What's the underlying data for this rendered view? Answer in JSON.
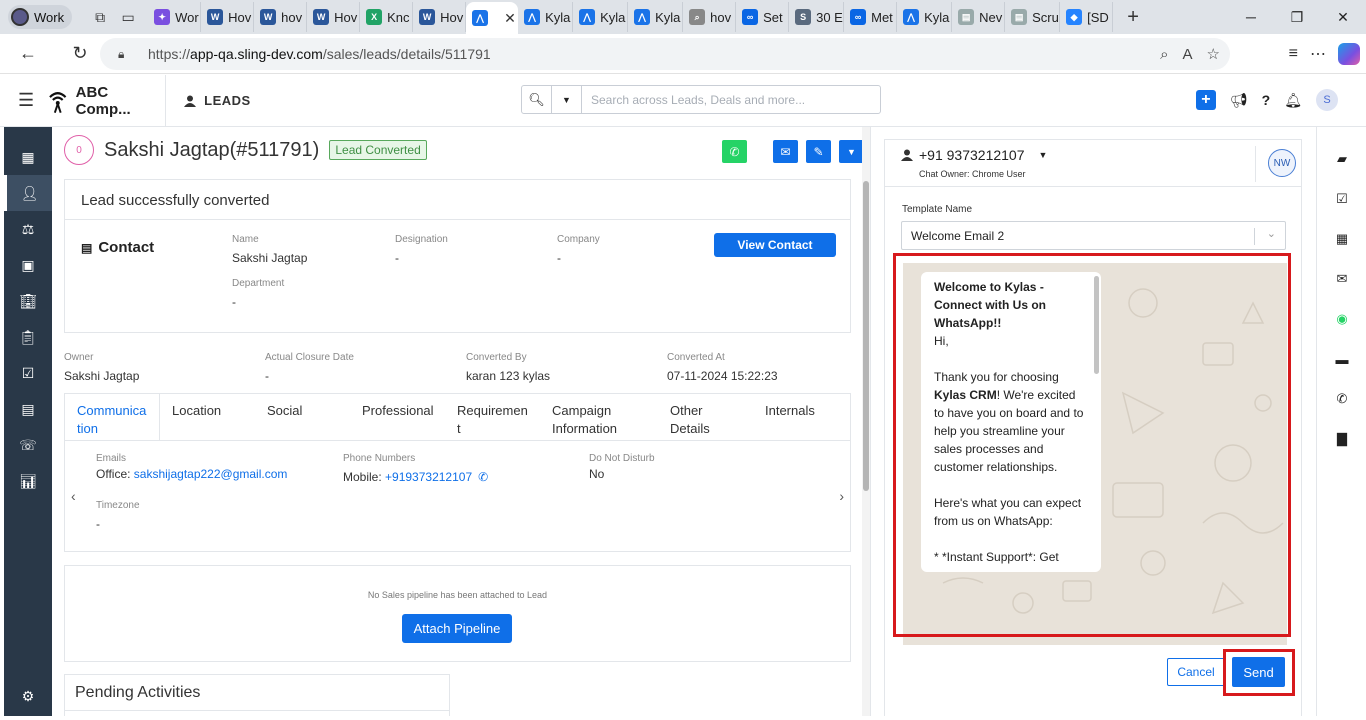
{
  "browser": {
    "profile_label": "Work",
    "tabs": [
      {
        "label": "Wor",
        "icon": "copilot-icon"
      },
      {
        "label": "Hov",
        "icon": "word-icon"
      },
      {
        "label": "hov",
        "icon": "word-icon"
      },
      {
        "label": "Hov",
        "icon": "word-icon"
      },
      {
        "label": "Knc",
        "icon": "excel-icon"
      },
      {
        "label": "Hov",
        "icon": "word-icon"
      },
      {
        "label": "",
        "icon": "kylas-icon"
      },
      {
        "label": "Kyla",
        "icon": "kylas-icon"
      },
      {
        "label": "Kyla",
        "icon": "kylas-icon"
      },
      {
        "label": "Kyla",
        "icon": "kylas-icon"
      },
      {
        "label": "hov",
        "icon": "search-icon"
      },
      {
        "label": "Set",
        "icon": "meta-icon"
      },
      {
        "label": "30 E",
        "icon": "s-icon"
      },
      {
        "label": "Met",
        "icon": "meta-icon"
      },
      {
        "label": "Kyla",
        "icon": "kylas-icon"
      },
      {
        "label": "Nev",
        "icon": "page-icon"
      },
      {
        "label": "Scru",
        "icon": "page-icon"
      },
      {
        "label": "[SD",
        "icon": "jira-icon"
      }
    ],
    "url_prefix": "https://",
    "url_host": "app-qa.sling-dev.com",
    "url_path": "/sales/leads/details/511791"
  },
  "header": {
    "company": "ABC Comp...",
    "module": "LEADS",
    "search_placeholder": "Search across Leads, Deals and more...",
    "avatar_letter": "S"
  },
  "lead": {
    "avatar_text": "0",
    "name": "Sakshi Jagtap(#511791)",
    "status_badge": "Lead Converted"
  },
  "conversion": {
    "banner": "Lead successfully converted",
    "contact_heading": "Contact",
    "name_label": "Name",
    "name_value": "Sakshi Jagtap",
    "designation_label": "Designation",
    "designation_value": "-",
    "company_label": "Company",
    "company_value": "-",
    "department_label": "Department",
    "department_value": "-",
    "view_contact": "View Contact"
  },
  "summary": {
    "owner_label": "Owner",
    "owner_value": "Sakshi Jagtap",
    "closure_label": "Actual Closure Date",
    "closure_value": "-",
    "converted_by_label": "Converted By",
    "converted_by_value": "karan 123 kylas",
    "converted_at_label": "Converted At",
    "converted_at_value": "07-11-2024 15:22:23"
  },
  "detail_tabs": [
    "Communica tion",
    "Location",
    "Social",
    "Professional",
    "Requiremen t",
    "Campaign Information",
    "Other Details",
    "Internals"
  ],
  "communication": {
    "emails_label": "Emails",
    "email_prefix": "Office: ",
    "email_value": "sakshijagtap222@gmail.com",
    "phones_label": "Phone Numbers",
    "phone_prefix": "Mobile: ",
    "phone_value": "+919373212107",
    "dnd_label": "Do Not Disturb",
    "dnd_value": "No",
    "timezone_label": "Timezone",
    "timezone_value": "-"
  },
  "pipeline": {
    "message": "No Sales pipeline has been attached to Lead",
    "button": "Attach Pipeline"
  },
  "pending": {
    "title": "Pending Activities"
  },
  "chat": {
    "phone": "+91 9373212107",
    "owner_label": "Chat Owner:",
    "owner_value": "Chrome User",
    "agent_initials": "NW",
    "template_label": "Template Name",
    "template_value": "Welcome Email 2",
    "message_title": "Welcome to Kylas - Connect with Us on WhatsApp!!",
    "message_greeting": "Hi,",
    "message_p1_a": "Thank you for choosing ",
    "message_p1_b": "Kylas CRM",
    "message_p1_c": "! We're excited to have you on board and to help you streamline your sales processes and customer relationships.",
    "message_p2": "Here's what you can expect from us on WhatsApp:",
    "message_p3": "* *Instant Support*: Get",
    "cancel": "Cancel",
    "send": "Send"
  },
  "colors": {
    "primary": "#0f6fe8",
    "sidebar": "#293848",
    "whatsapp": "#25d366",
    "highlight_red": "#d7191c",
    "converted_green": "#3f8f44"
  }
}
